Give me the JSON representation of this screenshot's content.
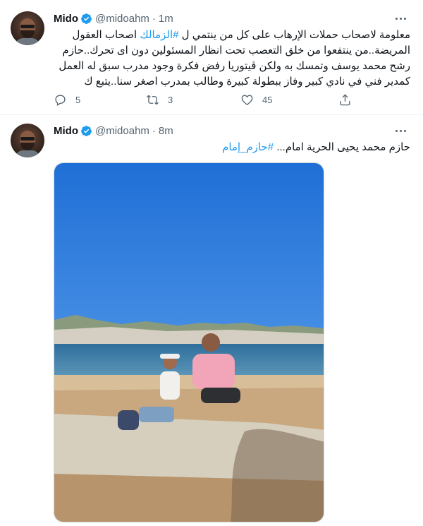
{
  "tweets": [
    {
      "author": {
        "name": "Mido",
        "handle": "@midoahm"
      },
      "separator": "·",
      "time": "1m",
      "text_before": "معلومة لاصحاب حملات الإرهاب على كل من ينتمي ل ",
      "hashtag": "#الزمالك",
      "text_after": " اصحاب العقول المريضة..من ينتفعوا من خلق التعصب تحت انظار المسئولين دون اى تحرك..حازم رشح محمد يوسف وتمسك به ولكن ڤيتوريا رفض فكرة وجود مدرب سبق له العمل كمدير فني في نادي كبير وفاز ببطولة كبيرة وطالب بمدرب اصغر سنا..يتبع ك",
      "actions": {
        "replies": "5",
        "retweets": "3",
        "likes": "45"
      }
    },
    {
      "author": {
        "name": "Mido",
        "handle": "@midoahm"
      },
      "separator": "·",
      "time": "8m",
      "text_before": "حازم محمد يحيى الحرية امام... ",
      "hashtag": "#حازم_إمام",
      "text_after": ""
    }
  ],
  "icons": {
    "verified": "verified-badge-icon",
    "more": "more-horizontal-icon",
    "reply": "reply-icon",
    "retweet": "retweet-icon",
    "like": "heart-icon",
    "share": "share-icon"
  },
  "colors": {
    "accent": "#1d9bf0",
    "text": "#0f1419",
    "secondary": "#536471",
    "divider": "#eff3f4"
  }
}
